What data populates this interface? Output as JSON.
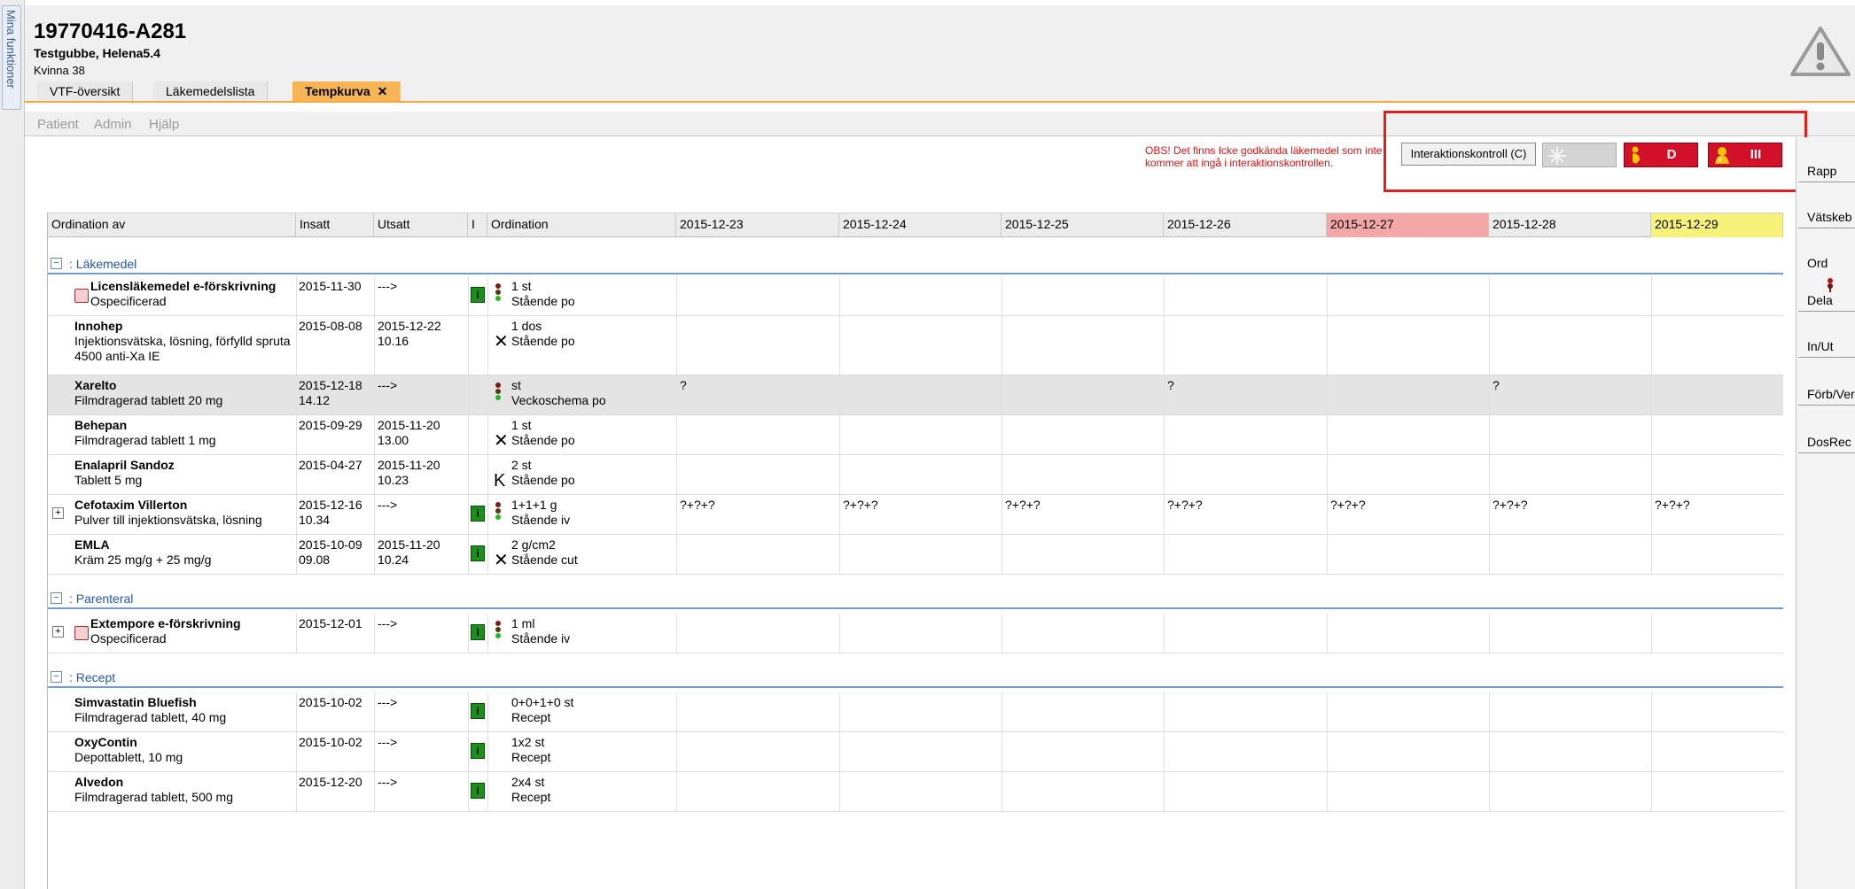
{
  "sidebar": {
    "tab_label": "Mina funktioner"
  },
  "patient": {
    "id": "19770416-A281",
    "name": "Testgubbe, Helena5.4",
    "gender_age": "Kvinna 38"
  },
  "tabs": [
    {
      "label": "VTF-översikt",
      "active": false
    },
    {
      "label": "Läkemedelslista",
      "active": false
    },
    {
      "label": "Tempkurva",
      "active": true,
      "close": "✕"
    }
  ],
  "menu": [
    "Patient",
    "Admin",
    "Hjälp"
  ],
  "toolbar": {
    "obs_text": "OBS! Det finns Icke godkända läkemedel som inte kommer att ingå i interaktionskontrollen.",
    "interaction_button": "Interaktionskontroll (C)",
    "d_button": "D",
    "iii_button": "III"
  },
  "right_panel": [
    "Rapp",
    "Vätskeb",
    "Ord",
    "Dela",
    "In/Ut",
    "Förb/Ver",
    "DosRec"
  ],
  "columns": {
    "ordination_av": "Ordination av",
    "insatt": "Insatt",
    "utsatt": "Utsatt",
    "i": "I",
    "ordination": "Ordination",
    "dates": [
      "2015-12-23",
      "2015-12-24",
      "2015-12-25",
      "2015-12-26",
      "2015-12-27",
      "2015-12-28",
      "2015-12-29"
    ]
  },
  "groups": {
    "lakemedel": ": Läkemedel",
    "parenteral": ": Parenteral",
    "recept": ": Recept"
  },
  "rows": [
    {
      "name": "Licensläkemedel e-förskrivning",
      "desc": "Ospecificerad",
      "insatt": "2015-11-30",
      "insatt2": "",
      "utsatt": "--->",
      "utsatt2": "",
      "dose": "1 st",
      "mode": "Stående po",
      "cells": [
        "",
        "",
        "",
        "",
        "",
        "",
        ""
      ]
    },
    {
      "name": "Innohep",
      "desc": "Injektionsvätska, lösning, förfylld spruta 4500 anti-Xa IE",
      "insatt": "2015-08-08",
      "insatt2": "",
      "utsatt": "2015-12-22",
      "utsatt2": "10.16",
      "dose": "1 dos",
      "mode": "Stående po",
      "cells": [
        "",
        "",
        "",
        "",
        "",
        "",
        ""
      ]
    },
    {
      "name": "Xarelto",
      "desc": "Filmdragerad tablett 20 mg",
      "insatt": "2015-12-18",
      "insatt2": "14.12",
      "utsatt": "--->",
      "utsatt2": "",
      "dose": "st",
      "mode": "Veckoschema po",
      "cells": [
        "?",
        "",
        "",
        "?",
        "",
        "?",
        ""
      ]
    },
    {
      "name": "Behepan",
      "desc": "Filmdragerad tablett 1 mg",
      "insatt": "2015-09-29",
      "insatt2": "",
      "utsatt": "2015-11-20",
      "utsatt2": "13.00",
      "dose": "1 st",
      "mode": "Stående po",
      "cells": [
        "",
        "",
        "",
        "",
        "",
        "",
        ""
      ]
    },
    {
      "name": "Enalapril Sandoz",
      "desc": "Tablett 5 mg",
      "insatt": "2015-04-27",
      "insatt2": "",
      "utsatt": "2015-11-20",
      "utsatt2": "10.23",
      "dose": "2 st",
      "mode": "Stående po",
      "cells": [
        "",
        "",
        "",
        "",
        "",
        "",
        ""
      ]
    },
    {
      "name": "Cefotaxim Villerton",
      "desc": "Pulver till injektionsvätska, lösning",
      "insatt": "2015-12-16",
      "insatt2": "10.34",
      "utsatt": "--->",
      "utsatt2": "",
      "dose": "1+1+1 g",
      "mode": "Stående iv",
      "cells": [
        "?+?+?",
        "?+?+?",
        "?+?+?",
        "?+?+?",
        "?+?+?",
        "?+?+?",
        "?+?+?"
      ]
    },
    {
      "name": "EMLA",
      "desc": "Kräm 25 mg/g + 25 mg/g",
      "insatt": "2015-10-09",
      "insatt2": "09.08",
      "utsatt": "2015-11-20",
      "utsatt2": "10.24",
      "dose": "2 g/cm2",
      "mode": "Stående cut",
      "cells": [
        "",
        "",
        "",
        "",
        "",
        "",
        ""
      ]
    },
    {
      "name": "Extempore e-förskrivning",
      "desc": "Ospecificerad",
      "insatt": "2015-12-01",
      "insatt2": "",
      "utsatt": "--->",
      "utsatt2": "",
      "dose": "1 ml",
      "mode": "Stående iv",
      "cells": [
        "",
        "",
        "",
        "",
        "",
        "",
        ""
      ]
    },
    {
      "name": "Simvastatin Bluefish",
      "desc": "Filmdragerad tablett, 40 mg",
      "insatt": "2015-10-02",
      "insatt2": "",
      "utsatt": "--->",
      "utsatt2": "",
      "dose": "0+0+1+0 st",
      "mode": "Recept",
      "cells": [
        "",
        "",
        "",
        "",
        "",
        "",
        ""
      ]
    },
    {
      "name": "OxyContin",
      "desc": "Depottablett, 10 mg",
      "insatt": "2015-10-02",
      "insatt2": "",
      "utsatt": "--->",
      "utsatt2": "",
      "dose": "1x2 st",
      "mode": "Recept",
      "cells": [
        "",
        "",
        "",
        "",
        "",
        "",
        ""
      ]
    },
    {
      "name": "Alvedon",
      "desc": "Filmdragerad tablett, 500 mg",
      "insatt": "2015-12-20",
      "insatt2": "",
      "utsatt": "--->",
      "utsatt2": "",
      "dose": "2x4 st",
      "mode": "Recept",
      "cells": [
        "",
        "",
        "",
        "",
        "",
        "",
        ""
      ]
    }
  ],
  "symbols": {
    "cross": "✕",
    "k": "K",
    "question": "?"
  },
  "colors": {
    "accent": "#f7b556",
    "alert_red": "#d2102a",
    "group_blue": "#2458a8",
    "today_pink": "#f3a7a7",
    "highlight_yellow": "#f7f27a"
  }
}
